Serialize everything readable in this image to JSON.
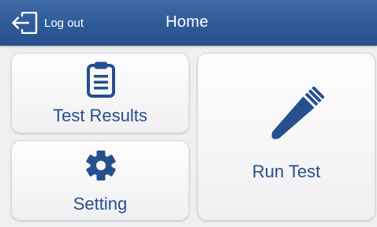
{
  "header": {
    "logout_label": "Log out",
    "title": "Home",
    "bar_color": "#2f5a98"
  },
  "tiles": {
    "test_results": {
      "label": "Test Results",
      "icon": "clipboard-icon"
    },
    "setting": {
      "label": "Setting",
      "icon": "gear-icon"
    },
    "run_test": {
      "label": "Run Test",
      "icon": "pipette-tip-icon"
    }
  },
  "colors": {
    "accent": "#264f8e",
    "tile_bg": "#f7f7f8",
    "page_bg": "#eeeff1"
  }
}
